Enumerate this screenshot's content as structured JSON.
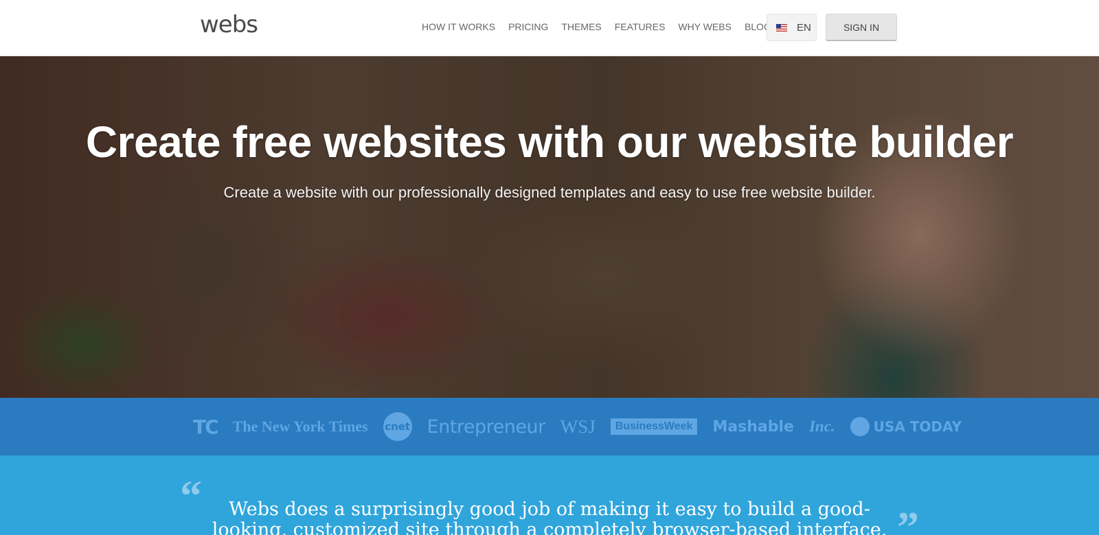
{
  "header": {
    "logo": "webs",
    "nav": [
      "HOW IT WORKS",
      "PRICING",
      "THEMES",
      "FEATURES",
      "WHY WEBS",
      "BLOG"
    ],
    "language": {
      "code": "EN",
      "flag": "us-flag-icon"
    },
    "sign_in": "SIGN IN"
  },
  "hero": {
    "title": "Create free websites with our website builder",
    "subtitle": "Create a website with our professionally designed templates and easy to use free website builder."
  },
  "press": {
    "logos": [
      "TC",
      "The New York Times",
      "cnet",
      "Entrepreneur",
      "WSJ",
      "BusinessWeek",
      "Mashable",
      "Inc.",
      "USA TODAY"
    ]
  },
  "quote": {
    "text": "Webs does a surprisingly good job of making it easy to build a good-looking, customized site through a completely browser-based interface."
  },
  "colors": {
    "press_bar": "#2a7bc0",
    "quote_bg": "#2fa5db",
    "sign_in_bg": "#e6e6e6"
  }
}
